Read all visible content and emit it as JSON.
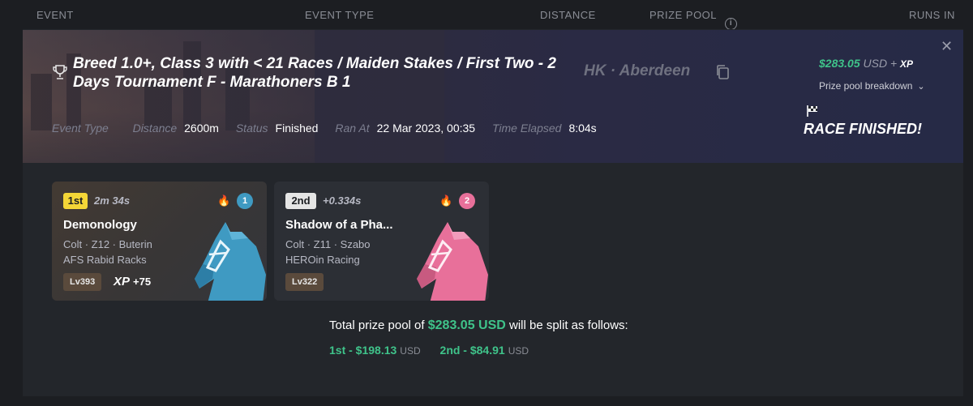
{
  "header": {
    "event": "EVENT",
    "event_type": "EVENT TYPE",
    "distance": "DISTANCE",
    "prize_pool": "PRIZE POOL",
    "runs_in": "RUNS IN",
    "info_glyph": "i"
  },
  "event": {
    "title": "Breed 1.0+, Class 3 with < 21 Races / Maiden Stakes / First Two - 2 Days Tournament F - Marathoners B 1",
    "location": "HK · Aberdeen",
    "close_glyph": "✕",
    "prize_amount": "$283.05",
    "prize_currency": "USD",
    "prize_plus": "+",
    "prize_xp": "XP",
    "breakdown_label": "Prize pool breakdown",
    "breakdown_chevron": "⌄",
    "race_status_banner": "RACE FINISHED!",
    "meta": {
      "event_type_label": "Event Type",
      "distance_label": "Distance",
      "distance_value": "2600m",
      "status_label": "Status",
      "status_value": "Finished",
      "ran_at_label": "Ran At",
      "ran_at_value": "22 Mar 2023, 00:35",
      "elapsed_label": "Time Elapsed",
      "elapsed_value": "8:04s"
    }
  },
  "results": [
    {
      "place": "1st",
      "time": "2m 34s",
      "gate": "1",
      "name": "Demonology",
      "meta": "Colt · Z12 · Buterin",
      "owner": "AFS Rabid Racks",
      "level": "Lv393",
      "xp_label": "XP",
      "xp_gain": "+75",
      "color": "#3f9ac2"
    },
    {
      "place": "2nd",
      "time": "+0.334s",
      "gate": "2",
      "name": "Shadow of a Pha...",
      "meta": "Colt · Z11 · Szabo",
      "owner": "HEROin Racing",
      "level": "Lv322",
      "color": "#e8709a"
    }
  ],
  "split": {
    "prefix": "Total prize pool of",
    "amount": "$283.05 USD",
    "suffix": "will be split as follows:",
    "first": "1st - $198.13",
    "second": "2nd - $84.91",
    "currency": "USD"
  },
  "icons": [
    "trophy-icon",
    "copy-icon",
    "info-icon",
    "close-icon",
    "chevron-down-icon",
    "checkered-flag-icon",
    "fire-icon",
    "horse-icon"
  ],
  "colors": {
    "accent_green": "#3fc38a",
    "first_badge": "#f4d637",
    "gate1": "#3f9ac2",
    "gate2": "#e8709a"
  }
}
